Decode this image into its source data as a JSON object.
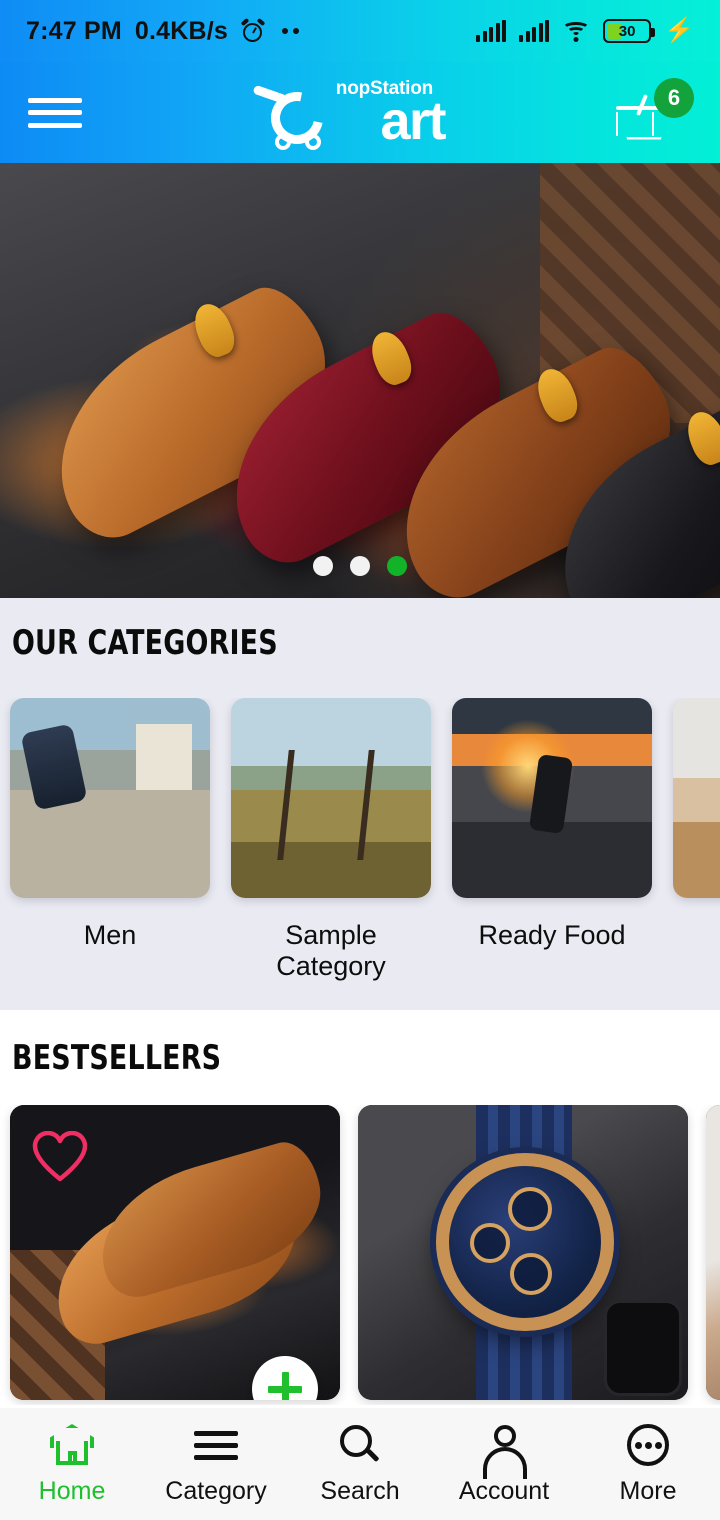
{
  "status_bar": {
    "time": "7:47 PM",
    "network_speed": "0.4KB/s",
    "alarm_icon": "alarm-clock-icon",
    "overflow_dots": "more-dots-icon",
    "signal_1": "signal-bars-icon",
    "signal_2": "signal-bars-icon",
    "wifi": "wifi-icon",
    "battery_percent": "30",
    "charging": "⚡"
  },
  "header": {
    "menu_icon": "hamburger-menu-icon",
    "brand_top": "nopStation",
    "brand_main": "art",
    "cart_icon": "shopping-basket-icon",
    "cart_count": "6",
    "gradient_from": "#0d8bf5",
    "gradient_to": "#03efd6"
  },
  "hero": {
    "slides_total": 3,
    "active_slide": 3,
    "dot_active_color": "#12b328",
    "dot_inactive_color": "#f2f2f2"
  },
  "categories": {
    "title": "OUR CATEGORIES",
    "background": "#eaeaf2",
    "items": [
      {
        "label": "Men",
        "thumb": "skateboarder-palm-trees-image"
      },
      {
        "label": "Sample Category",
        "thumb": "swing-bench-coastal-field-image"
      },
      {
        "label": "Ready Food",
        "thumb": "skatepark-sunset-image"
      },
      {
        "label": "",
        "thumb": "beach-cliff-image"
      }
    ]
  },
  "bestsellers": {
    "title": "BESTSELLERS",
    "products": [
      {
        "image": "brown-crocodile-leather-dress-shoes-image",
        "wishlist_icon": "heart-outline-icon",
        "wishlist_color": "#ef2e63",
        "add_icon": "plus-icon",
        "add_color": "#1fbf2e"
      },
      {
        "image": "blue-rose-gold-chronograph-watch-image"
      },
      {
        "image": "product-peek-image"
      }
    ]
  },
  "bottom_nav": {
    "active_color": "#1fbf2e",
    "items": [
      {
        "label": "Home",
        "icon": "home-icon",
        "active": true
      },
      {
        "label": "Category",
        "icon": "list-lines-icon",
        "active": false
      },
      {
        "label": "Search",
        "icon": "magnifier-icon",
        "active": false
      },
      {
        "label": "Account",
        "icon": "person-icon",
        "active": false
      },
      {
        "label": "More",
        "icon": "ellipsis-circle-icon",
        "active": false
      }
    ]
  }
}
